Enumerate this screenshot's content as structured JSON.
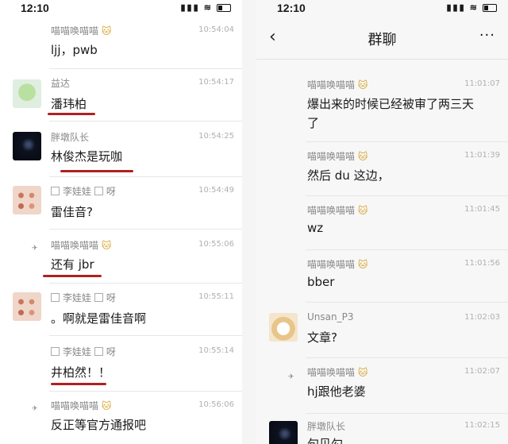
{
  "left": {
    "status": {
      "time": "12:10"
    },
    "messages": [
      {
        "name": "喵喵唤喵喵",
        "badge": "🐱",
        "time": "10:54:04",
        "text": "ljj，pwb"
      },
      {
        "name": "益达",
        "time": "10:54:17",
        "text": "潘玮柏"
      },
      {
        "name": "胖墩队长",
        "time": "10:54:25",
        "text": "林俊杰是玩咖"
      },
      {
        "name": "李娃娃",
        "suffix": "呀",
        "time": "10:54:49",
        "text": "雷佳音?"
      },
      {
        "name": "喵喵唤喵喵",
        "badge": "🐱",
        "time": "10:55:06",
        "text": "还有 jbr"
      },
      {
        "name": "李娃娃",
        "suffix": "呀",
        "time": "10:55:11",
        "text": "。啊就是雷佳音啊"
      },
      {
        "name": "李娃娃",
        "suffix": "呀",
        "time": "10:55:14",
        "text": "井柏然！！"
      },
      {
        "name": "喵喵唤喵喵",
        "badge": "🐱",
        "time": "10:56:06",
        "text": "反正等官方通报吧"
      }
    ]
  },
  "right": {
    "status": {
      "time": "12:10"
    },
    "nav": {
      "back": "‹",
      "title": "群聊",
      "more": "···"
    },
    "messages": [
      {
        "name": "喵喵唤喵喵",
        "badge": "🐱",
        "time": "11:01:07",
        "text1": "爆出来的时候已经被审了两三天",
        "text2": "了"
      },
      {
        "name": "喵喵唤喵喵",
        "badge": "🐱",
        "time": "11:01:39",
        "text": "然后 du 这边，"
      },
      {
        "name": "喵喵唤喵喵",
        "badge": "🐱",
        "time": "11:01:45",
        "text": "wz"
      },
      {
        "name": "喵喵唤喵喵",
        "badge": "🐱",
        "time": "11:01:56",
        "text": "bber"
      },
      {
        "name": "Unsan_P3",
        "time": "11:02:03",
        "text": "文章?"
      },
      {
        "name": "喵喵唤喵喵",
        "badge": "🐱",
        "time": "11:02:07",
        "text": "hj跟他老婆"
      },
      {
        "name": "胖墩队长",
        "time": "11:02:15",
        "text": "句贝勾"
      }
    ]
  }
}
